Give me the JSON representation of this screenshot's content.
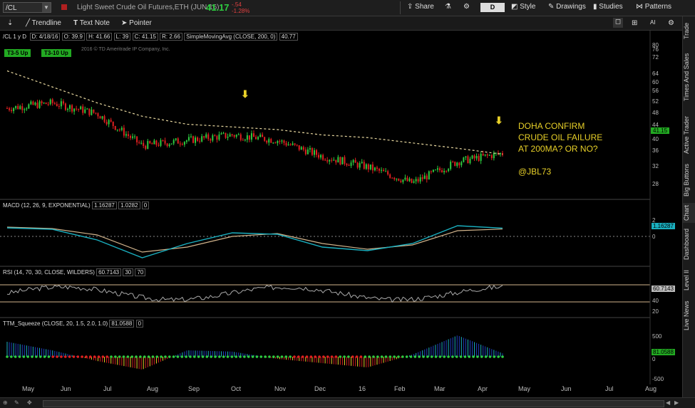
{
  "toolbar": {
    "symbol": "/CL",
    "description": "Light Sweet Crude Oil Futures,ETH (JUN 16)",
    "last": "41.17",
    "change": "-.54",
    "change_pct": "-1.28%",
    "share": "Share",
    "timeframe": "D",
    "style": "Style",
    "drawings": "Drawings",
    "studies": "Studies",
    "patterns": "Patterns"
  },
  "drawtools": {
    "trendline": "Trendline",
    "textnote": "Text Note",
    "pointer": "Pointer"
  },
  "sidebar_tabs": [
    "Trade",
    "Times And Sales",
    "Active Trader",
    "Big Buttons",
    "Chart",
    "Dashboard",
    "Level II",
    "Live News"
  ],
  "chart_header": {
    "symbol_period": "/CL 1 y D",
    "date": "D: 4/18/16",
    "open": "O: 39.9",
    "high": "H: 41.66",
    "low": "L: 39",
    "close": "C: 41.15",
    "range": "R: 2.66",
    "study": "SimpleMovingAvg (CLOSE, 200, 0)",
    "study_val": "40.77",
    "copyright": "2016 © TD Ameritrade IP Company, Inc.",
    "badge1": "T3-5 Up",
    "badge2": "T3-10 Up",
    "last_label": "41.15"
  },
  "price_axis": [
    "80",
    "76",
    "72",
    "64",
    "60",
    "56",
    "52",
    "48",
    "44",
    "40",
    "36",
    "32",
    "28"
  ],
  "annotation": [
    "DOHA CONFIRM",
    "CRUDE OIL FAILURE",
    "AT 200MA? OR NO?",
    "",
    "@JBL73"
  ],
  "macd": {
    "name": "MACD (12, 26, 9, EXPONENTIAL)",
    "v1": "1.16287",
    "v2": "1.0282",
    "v3": "0",
    "last_label": "1.16287",
    "axis": [
      "2",
      "0"
    ]
  },
  "rsi": {
    "name": "RSI (14, 70, 30, CLOSE, WILDERS)",
    "v1": "60.7143",
    "v2": "30",
    "v3": "70",
    "last_label": "60.7143",
    "axis": [
      "40",
      "20"
    ]
  },
  "ttm": {
    "name": "TTM_Squeeze (CLOSE, 20, 1.5, 2.0, 1.0)",
    "v1": "81.0588",
    "v2": "0",
    "last_label": "81.0588",
    "axis": [
      "500",
      "0",
      "-500"
    ]
  },
  "months": [
    "May",
    "Jun",
    "Jul",
    "Aug",
    "Sep",
    "Oct",
    "Nov",
    "Dec",
    "16",
    "Feb",
    "Mar",
    "Apr",
    "May",
    "Jun",
    "Jul",
    "Aug"
  ],
  "colors": {
    "up": "#2ecc40",
    "down": "#e02020",
    "sma": "#e8d8a0",
    "macd": "#1ab0c0",
    "signal": "#d2b48c",
    "annotation": "#e8d028"
  },
  "chart_data": {
    "type": "candlestick",
    "title": "Light Sweet Crude Oil Futures,ETH (JUN 16)",
    "x_categories": [
      "May",
      "Jun",
      "Jul",
      "Aug",
      "Sep",
      "Oct",
      "Nov",
      "Dec",
      "16",
      "Feb",
      "Mar",
      "Apr"
    ],
    "close_by_month": [
      58,
      60,
      56,
      44,
      46,
      48,
      46,
      40,
      36,
      30,
      38,
      41.15
    ],
    "sma200": [
      72,
      66,
      60,
      55,
      52,
      51,
      50,
      48,
      47,
      45,
      43,
      40.77
    ],
    "ylim": [
      26,
      82
    ]
  }
}
